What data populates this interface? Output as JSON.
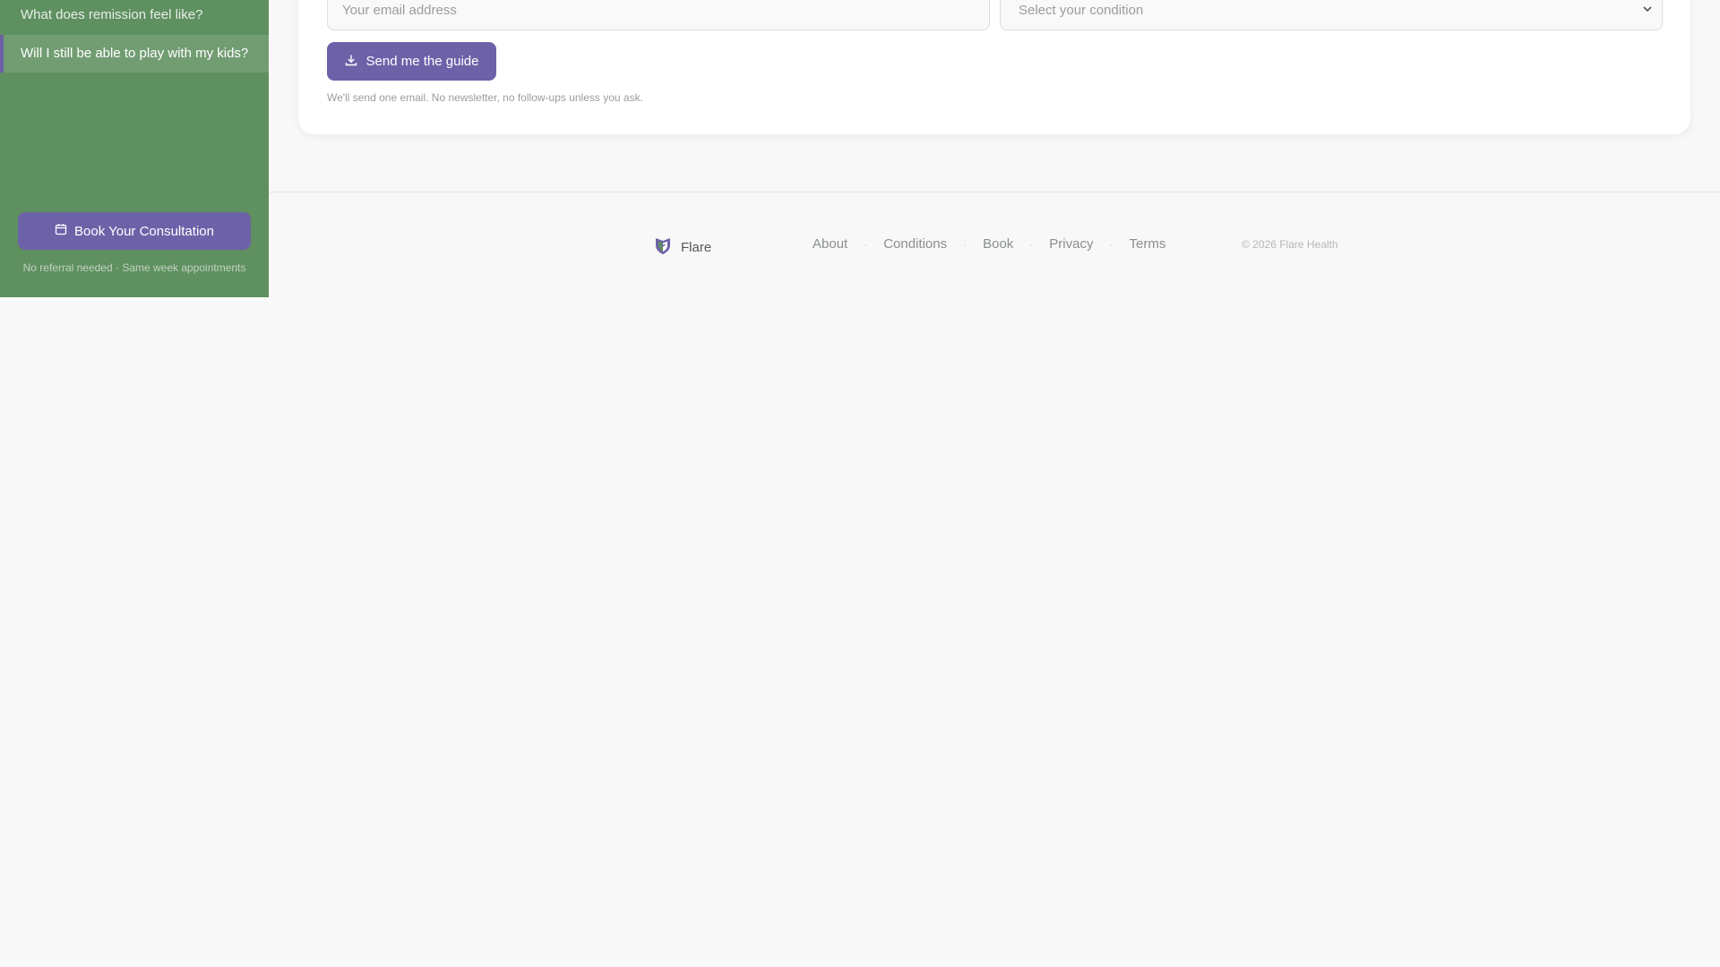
{
  "sidebar": {
    "items": [
      {
        "label": "What does remission feel like?"
      },
      {
        "label": "Will I still be able to play with my kids?"
      }
    ],
    "book_button": {
      "label": "Book Your Consultation",
      "icon": "calendar-icon"
    },
    "book_note": "No referral needed · Same week appointments"
  },
  "guide_form": {
    "email_placeholder": "Your email address",
    "condition_select": {
      "selected": "Select your condition"
    },
    "send_button": {
      "label": "Send me the guide",
      "icon": "download-icon"
    },
    "fine_print": "We'll send one email. No newsletter, no follow-ups unless you ask."
  },
  "footer": {
    "brand": {
      "name": "Flare",
      "icon": "shield-logo-icon"
    },
    "links": [
      "About",
      "Conditions",
      "Book",
      "Privacy",
      "Terms"
    ],
    "copyright": "© 2026 Flare Health"
  },
  "colors": {
    "sidebar_green": "#5f9060",
    "accent_purple": "#6d62a8",
    "page_background": "#f7f8f7"
  }
}
